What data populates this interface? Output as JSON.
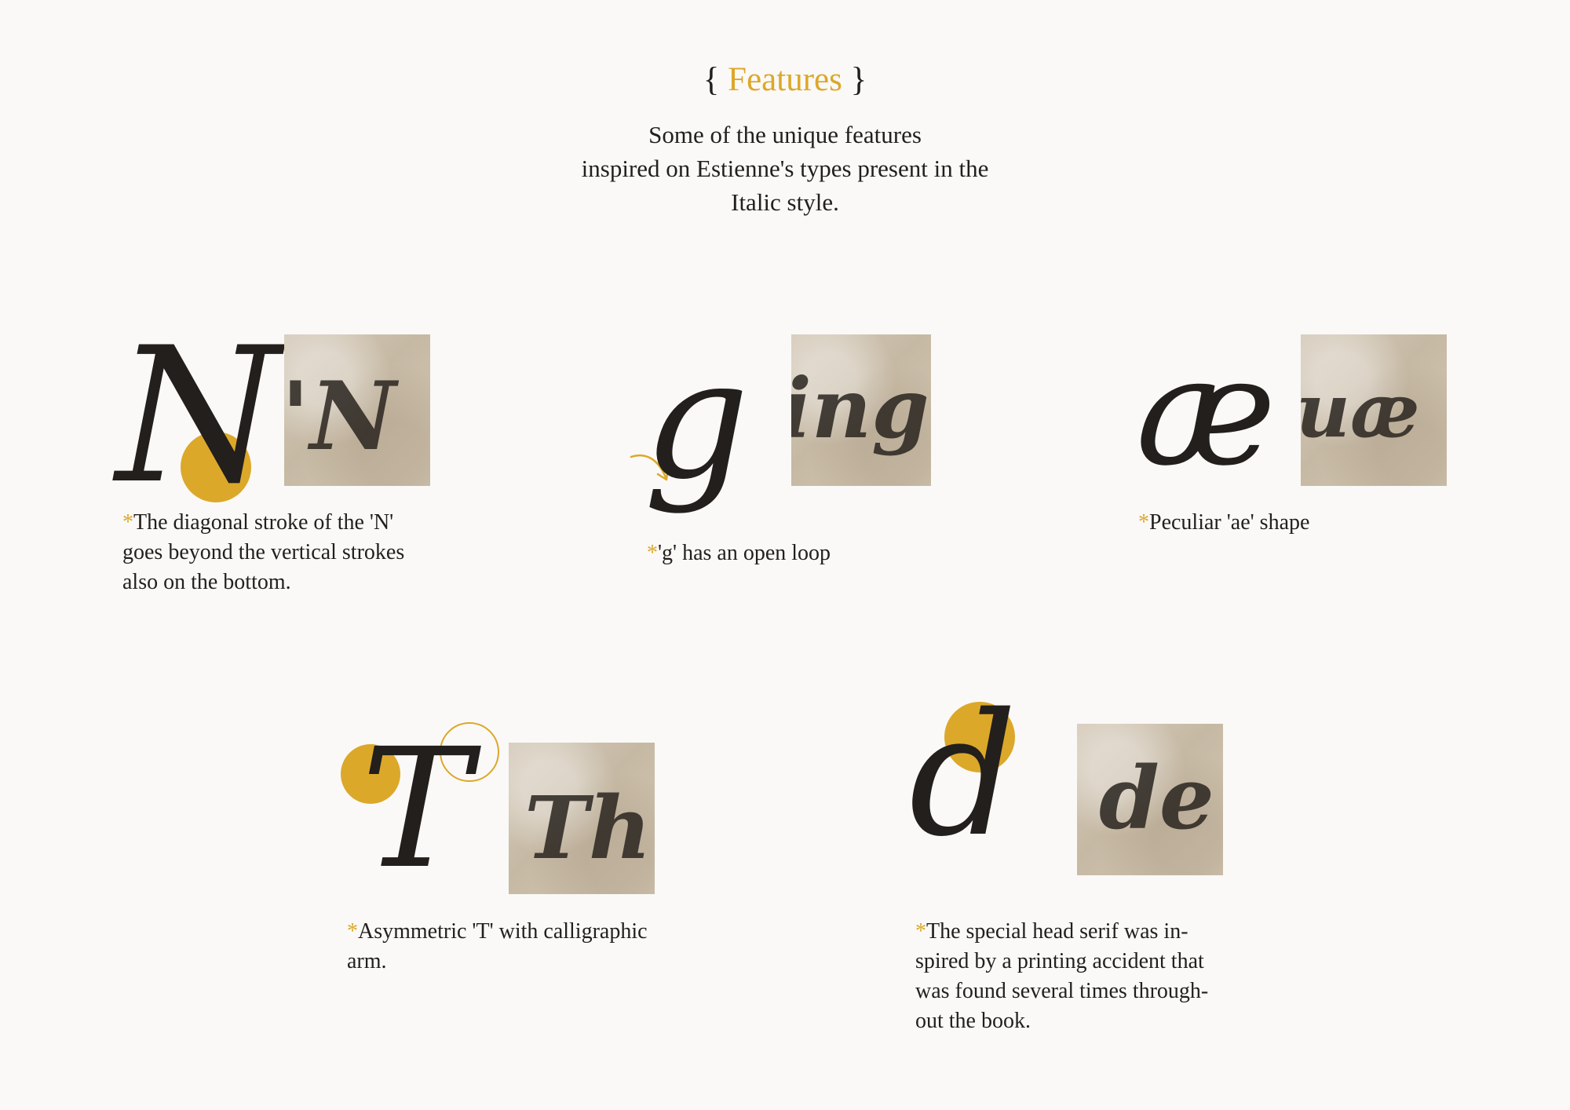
{
  "header": {
    "title_open": "{",
    "title": "Features",
    "title_close": "}",
    "intro_lines": [
      "Some of the unique features",
      "inspired on Estienne's types present in the",
      "Italic style."
    ]
  },
  "features": [
    {
      "glyph": "N",
      "specimen_text": "'N",
      "asterisk": "*",
      "caption_lines": [
        "The diagonal stroke of the 'N'",
        "goes beyond the vertical strokes",
        "also on the bottom."
      ]
    },
    {
      "glyph": "g",
      "specimen_text": "ingu",
      "asterisk": "*",
      "caption_lines": [
        "'g' has an open loop"
      ]
    },
    {
      "glyph": "æ",
      "specimen_text": "uæ p",
      "asterisk": "*",
      "caption_lines": [
        "Peculiar 'ae' shape"
      ]
    },
    {
      "glyph": "T",
      "specimen_text": "Th",
      "asterisk": "*",
      "caption_lines": [
        "Asymmetric 'T' with calligraphic",
        "arm."
      ]
    },
    {
      "glyph": "d",
      "specimen_text": "de",
      "asterisk": "*",
      "caption_lines": [
        "The special head serif was in-",
        "spired by a printing accident that",
        "was found several times through-",
        "out the book."
      ]
    }
  ],
  "colors": {
    "accent": "#dca82a",
    "text": "#221f1c",
    "background": "#faf9f7",
    "paper": "#cfc4b2"
  },
  "icons": [
    "arrow-icon",
    "highlight-dot",
    "highlight-ring"
  ]
}
